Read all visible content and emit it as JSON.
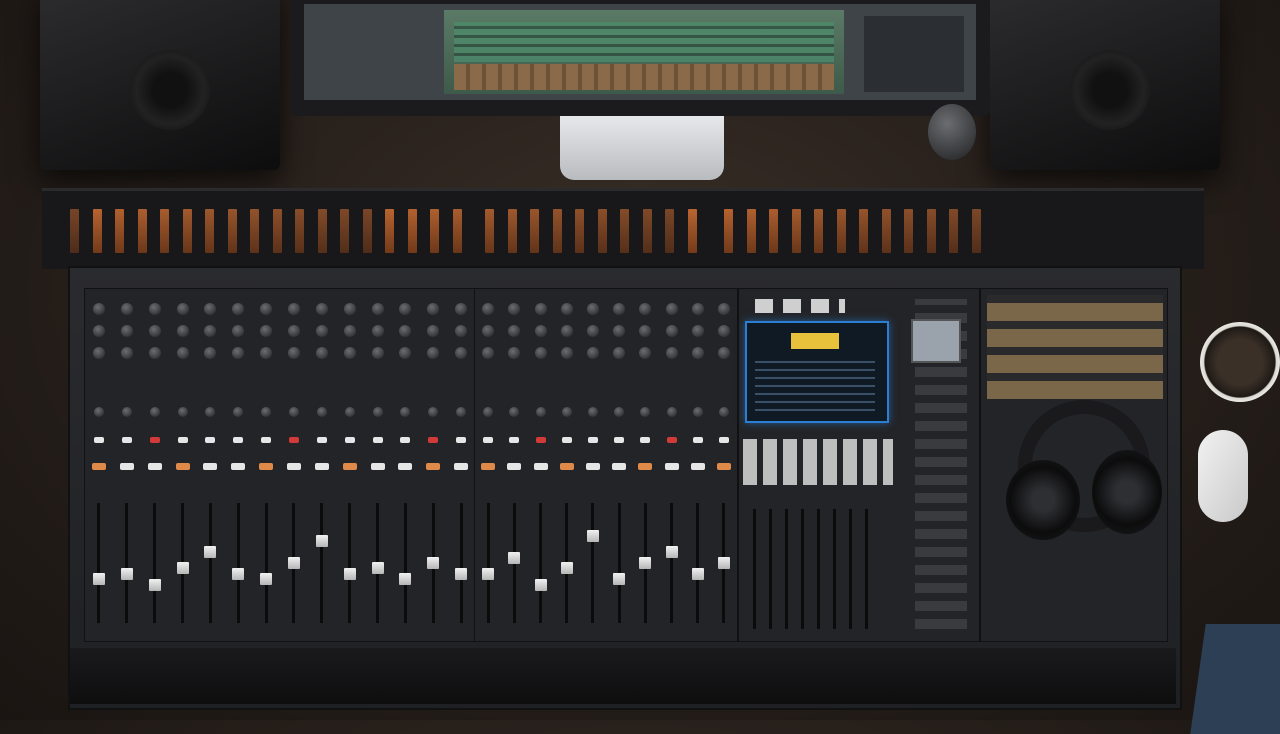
{
  "scene": {
    "description_items": [
      "mixing-console",
      "monitor",
      "studio-speakers",
      "headphones",
      "coffee-mug",
      "mouse"
    ]
  },
  "colors": {
    "meter_orange": "#c46a32",
    "display_blue": "#2a7fd4",
    "display_yellow": "#e8c23a",
    "button_orange": "#e08a4a",
    "button_white": "#e6e6e6",
    "button_red": "#d23a3a"
  },
  "channel_strips": {
    "left_bank_count": 14,
    "center_bank_count": 10,
    "fader_levels_left": [
      0.35,
      0.4,
      0.3,
      0.45,
      0.6,
      0.4,
      0.35,
      0.5,
      0.7,
      0.4,
      0.45,
      0.35,
      0.5,
      0.4
    ],
    "fader_levels_center": [
      0.4,
      0.55,
      0.3,
      0.45,
      0.75,
      0.35,
      0.5,
      0.6,
      0.4,
      0.5
    ]
  }
}
